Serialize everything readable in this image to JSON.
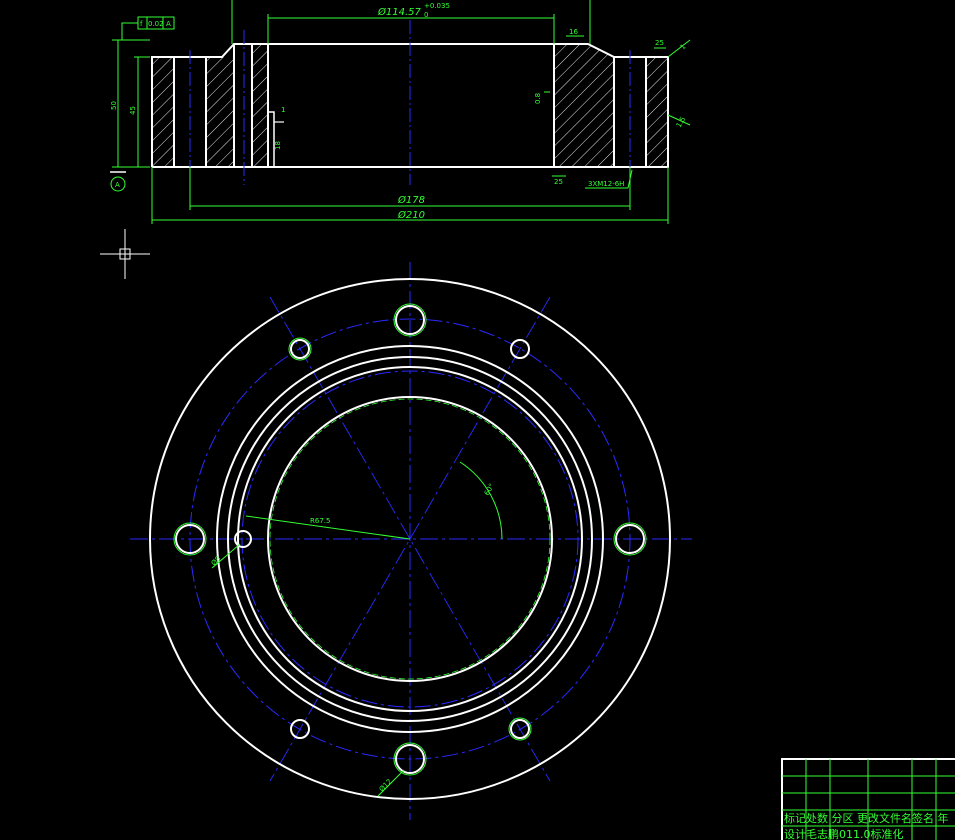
{
  "section_view": {
    "tolerance_frame": {
      "symbol": "f",
      "value": "0.02",
      "datum": "A"
    },
    "dim_bore": "Ø114.57",
    "dim_bore_tol": "+0.035",
    "dim_bore_tol_low": "0",
    "dim_178": "Ø178",
    "dim_210": "Ø210",
    "dim_thread": "3XM12-6H",
    "dim_50": "50",
    "dim_45": "45",
    "dim_18": "18",
    "dim_1": "1",
    "dim_16": "16",
    "dim_25": "25",
    "dim_25_lower": "25",
    "dim_right_1": "1",
    "dim_right_2": "1.5",
    "datum_label": "A",
    "dim_r_small": "0.8"
  },
  "plan_view": {
    "radius_label": "R67.5",
    "angle_label": "60°",
    "hole_label_left": "Ø8",
    "hole_label_bottom": "Ø12"
  },
  "title_block": {
    "row1": "标记处数 分区 更改文件名签名 年",
    "row2": "设计毛志鹏011.0标准化"
  },
  "colors": {
    "outline": "#ffffff",
    "dimension": "#33ff33",
    "center_line": "#2a2aff",
    "background": "#000000"
  }
}
